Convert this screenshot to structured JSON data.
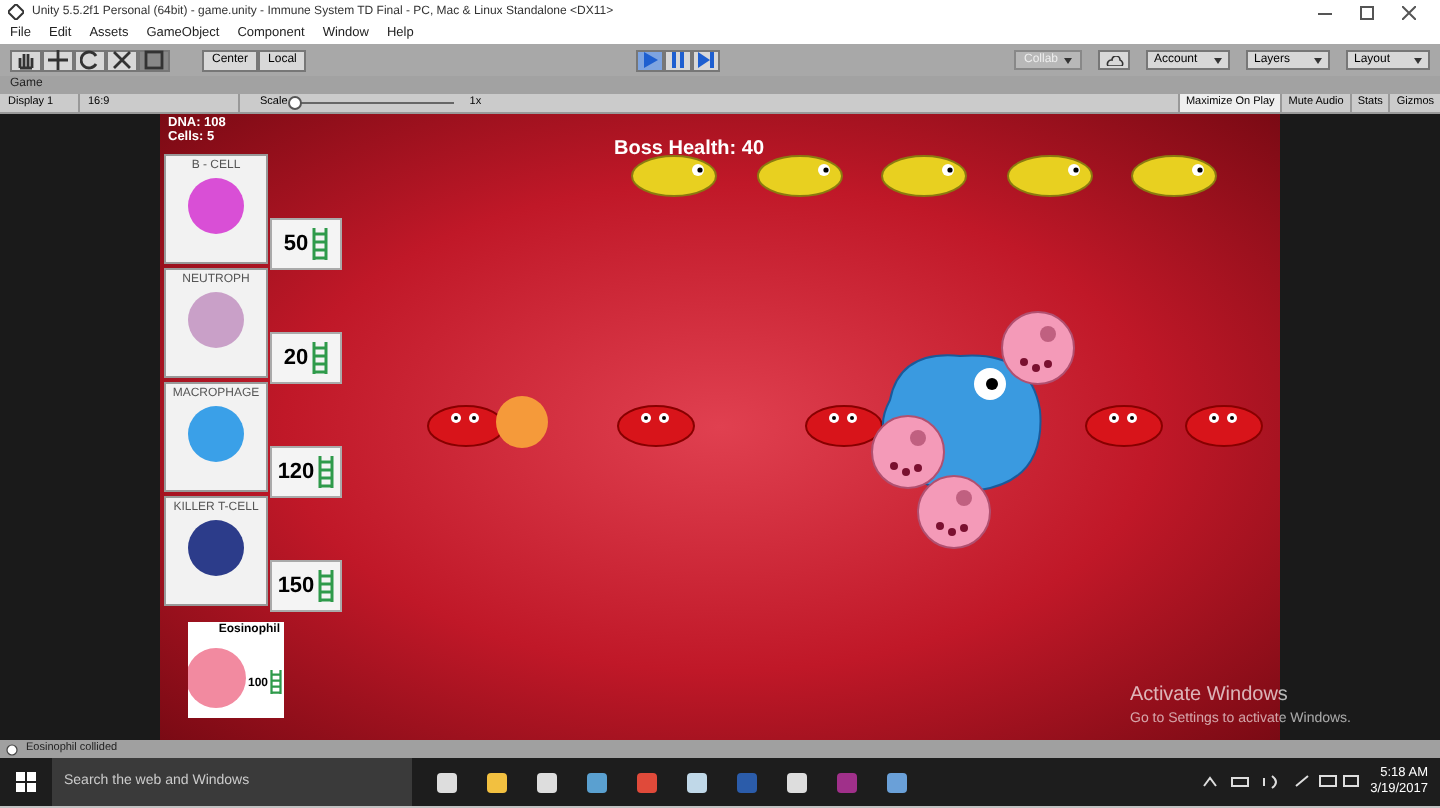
{
  "window": {
    "title": "Unity 5.5.2f1 Personal (64bit) - game.unity - Immune System TD Final - PC, Mac & Linux Standalone <DX11>"
  },
  "menu": [
    "File",
    "Edit",
    "Assets",
    "GameObject",
    "Component",
    "Window",
    "Help"
  ],
  "toolbar": {
    "tools": [
      {
        "kind": "hand",
        "selected": false
      },
      {
        "kind": "move",
        "selected": false
      },
      {
        "kind": "rotate",
        "selected": false
      },
      {
        "kind": "scale",
        "selected": false
      },
      {
        "kind": "rect",
        "selected": true
      }
    ],
    "pivot": [
      "Center",
      "Local"
    ],
    "play": [
      {
        "kind": "play",
        "selected": true
      },
      {
        "kind": "pause",
        "selected": false
      },
      {
        "kind": "step",
        "selected": false
      }
    ],
    "right": [
      {
        "kind": "collab",
        "label": "Collab"
      },
      {
        "kind": "cloud"
      },
      {
        "kind": "dropdown",
        "label": "Account"
      },
      {
        "kind": "dropdown",
        "label": "Layers"
      },
      {
        "kind": "dropdown",
        "label": "Layout"
      }
    ]
  },
  "game_view": {
    "tab": "Game",
    "display": "Display 1",
    "aspect": "16:9",
    "scale_label": "Scale",
    "scale": "1x",
    "level": 0.0,
    "options": [
      {
        "label": "Maximize On Play",
        "selected": true
      },
      {
        "label": "Mute Audio",
        "selected": false
      },
      {
        "label": "Stats",
        "selected": false
      },
      {
        "label": "Gizmos",
        "selected": false
      }
    ]
  },
  "hud": {
    "dna": "DNA: 108",
    "cells": "Cells: 5",
    "boss_health": "Boss Health: 40"
  },
  "cards": [
    {
      "kind": "shop",
      "name": "B - CELL",
      "cost": "50",
      "color": "#d94fd6"
    },
    {
      "kind": "shop",
      "name": "NEUTROPH",
      "cost": "20",
      "color": "#c9a0c8"
    },
    {
      "kind": "shop",
      "name": "MACROPHAGE",
      "cost": "120",
      "color": "#3aa0e8"
    },
    {
      "kind": "shop",
      "name": "KILLER T-CELL",
      "cost": "150",
      "color": "#2c3c8a"
    },
    {
      "kind": "featured",
      "name": "Eosinophil",
      "cost": "100",
      "color": "#f28aa0"
    }
  ],
  "activation": {
    "title": "Activate Windows",
    "message": "Go to Settings to activate Windows."
  },
  "status_bar": "Eosinophil collided",
  "taskbar": {
    "search": "Search the web and Windows",
    "time": "5:18 AM",
    "date": "3/19/2017"
  }
}
